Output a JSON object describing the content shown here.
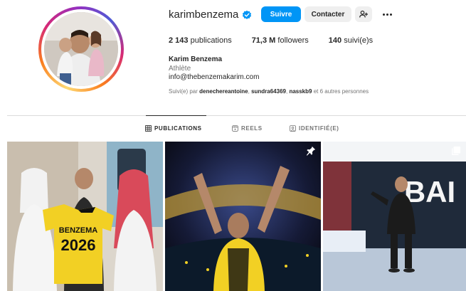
{
  "profile": {
    "username": "karimbenzema",
    "verified_icon": "verified-badge-icon",
    "follow_label": "Suivre",
    "contact_label": "Contacter",
    "add_user_icon": "add-user-icon",
    "more_icon": "more-options-icon",
    "stats": {
      "posts_count": "2 143",
      "posts_label": "publications",
      "followers_count": "71,3 M",
      "followers_label": "followers",
      "following_count": "140",
      "following_label": "suivi(e)s"
    },
    "full_name": "Karim Benzema",
    "category": "Athlète",
    "email": "info@thebenzemakarim.com",
    "followed_by": {
      "prefix": "Suivi(e) par",
      "account1": "denechereantoine",
      "account2": "sundra64369",
      "account3": "nasskb9",
      "suffix": "et 6 autres personnes"
    }
  },
  "tabs": [
    {
      "label": "PUBLICATIONS",
      "icon": "grid-icon",
      "active": true
    },
    {
      "label": "REELS",
      "icon": "reels-icon",
      "active": false
    },
    {
      "label": "IDENTIFIÉ(E)",
      "icon": "tagged-icon",
      "active": false
    }
  ],
  "posts": [
    {
      "jersey_name": "BENZEMA",
      "jersey_number": "2026",
      "icon": null
    },
    {
      "icon": "pin-icon"
    },
    {
      "banner_text": "BAI",
      "icon": "carousel-icon"
    }
  ],
  "colors": {
    "accent": "#0095f6",
    "secondary_button": "#efefef",
    "jersey_yellow": "#f2d024"
  }
}
